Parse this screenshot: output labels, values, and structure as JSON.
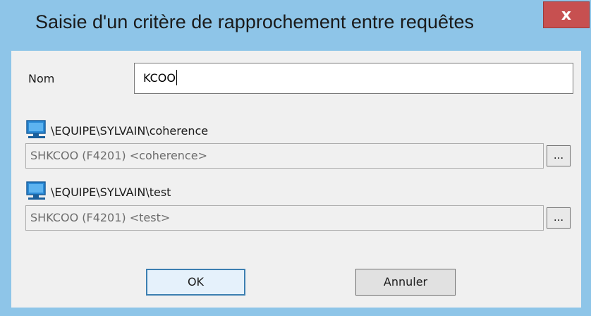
{
  "window": {
    "title": "Saisie d'un critère de rapprochement entre requêtes",
    "close_label": "x"
  },
  "form": {
    "name_label": "Nom",
    "name_value": "KCOO"
  },
  "queries": [
    {
      "path": "\\EQUIPE\\SYLVAIN\\coherence",
      "field": "SHKCOO (F4201) <coherence>",
      "browse_label": "..."
    },
    {
      "path": "\\EQUIPE\\SYLVAIN\\test",
      "field": "SHKCOO (F4201) <test>",
      "browse_label": "..."
    }
  ],
  "buttons": {
    "ok_label": "OK",
    "cancel_label": "Annuler"
  },
  "icons": [
    "computer-icon"
  ],
  "colors": {
    "titlebar": "#8ec5e8",
    "close": "#c75050",
    "client": "#f0f0f0",
    "default_button_border": "#3c7fb1"
  }
}
